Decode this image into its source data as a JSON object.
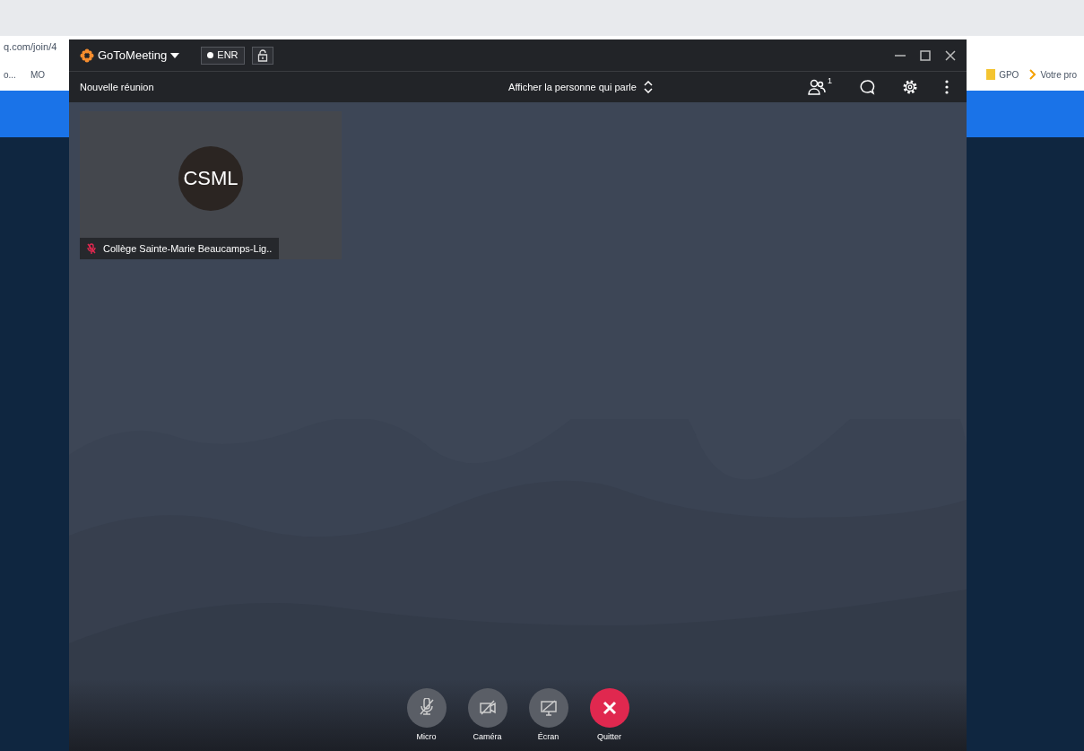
{
  "browser": {
    "address": "q.com/join/4",
    "bookmarks_left": [
      {
        "label": "o..."
      },
      {
        "label": "MO"
      }
    ],
    "bookmarks_right": [
      {
        "label": "GPO",
        "kind": "folder"
      },
      {
        "label": "Votre pro",
        "kind": "chevron"
      }
    ]
  },
  "app": {
    "title_logo": "GoToMeeting",
    "recording": "ENR",
    "meeting_name": "Nouvelle réunion",
    "view_mode": "Afficher la personne qui parle",
    "participant_count": "1"
  },
  "tiles": [
    {
      "initials": "CSML",
      "name": "Collège Sainte-Marie Beaucamps-Lig..",
      "muted": true
    }
  ],
  "controls": [
    {
      "kind": "mic",
      "label": "Micro"
    },
    {
      "kind": "camera",
      "label": "Caméra"
    },
    {
      "kind": "screen",
      "label": "Écran"
    },
    {
      "kind": "leave",
      "label": "Quitter"
    }
  ]
}
